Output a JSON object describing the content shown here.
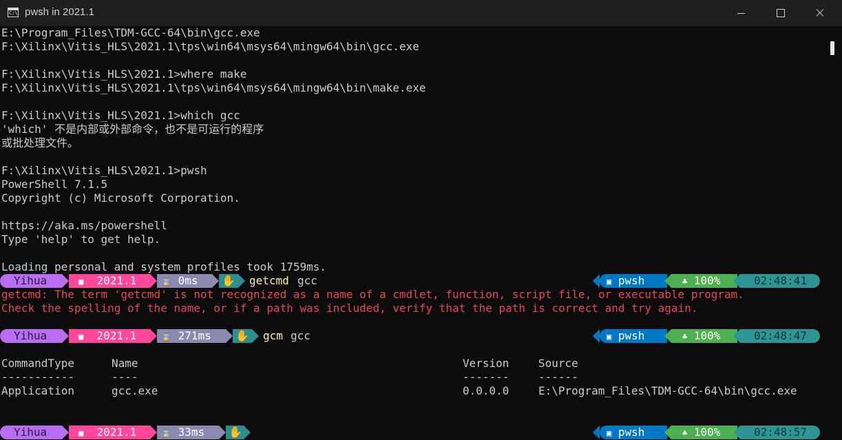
{
  "window": {
    "title": "pwsh in 2021.1"
  },
  "console": {
    "lines": [
      "E:\\Program_Files\\TDM-GCC-64\\bin\\gcc.exe",
      "F:\\Xilinx\\Vitis_HLS\\2021.1\\tps\\win64\\msys64\\mingw64\\bin\\gcc.exe",
      "",
      "F:\\Xilinx\\Vitis_HLS\\2021.1>where make",
      "F:\\Xilinx\\Vitis_HLS\\2021.1\\tps\\win64\\msys64\\mingw64\\bin\\make.exe",
      "",
      "F:\\Xilinx\\Vitis_HLS\\2021.1>which gcc",
      "'which' 不是内部或外部命令，也不是可运行的程序",
      "或批处理文件。",
      "",
      "F:\\Xilinx\\Vitis_HLS\\2021.1>pwsh",
      "PowerShell 7.1.5",
      "Copyright (c) Microsoft Corporation.",
      "",
      "https://aka.ms/powershell",
      "Type 'help' to get help.",
      "",
      "Loading personal and system profiles took 1759ms."
    ],
    "errors": [
      "getcmd: The term 'getcmd' is not recognized as a name of a cmdlet, function, script file, or executable program.",
      "Check the spelling of the name, or if a path was included, verify that the path is correct and try again."
    ],
    "table": {
      "headers": [
        "CommandType",
        "Name",
        "Version",
        "Source"
      ],
      "dashes": [
        "-----------",
        "----",
        "-------",
        "------"
      ],
      "row": [
        "Application",
        "gcc.exe",
        "0.0.0.0",
        "E:\\Program_Files\\TDM-GCC-64\\bin\\gcc.exe"
      ]
    }
  },
  "prompts": [
    {
      "user": "Yihua",
      "folder": "2021.1",
      "elapsed": "0ms",
      "command": "getcmd",
      "arg": "gcc",
      "shell": "pwsh",
      "battery": "100%",
      "clock": "02:48:41"
    },
    {
      "user": "Yihua",
      "folder": "2021.1",
      "elapsed": "271ms",
      "command": "gcm",
      "arg": "gcc",
      "shell": "pwsh",
      "battery": "100%",
      "clock": "02:48:47"
    },
    {
      "user": "Yihua",
      "folder": "2021.1",
      "elapsed": "33ms",
      "command": "",
      "arg": "",
      "shell": "pwsh",
      "battery": "100%",
      "clock": "02:48:57"
    }
  ],
  "colors": {
    "background": "#0c0c0c",
    "text": "#cccccc",
    "error": "#e74856",
    "command": "#f9f1a5",
    "user_segment": "#b86df2",
    "path_segment": "#ff479c",
    "time_segment": "#8a8ab0",
    "git_segment": "#2b8f8f",
    "shell_segment": "#0077c2",
    "battery_segment": "#4caf50",
    "clock_segment": "#2d9595"
  },
  "icons": {
    "folder": "folder-icon",
    "hourglass": "hourglass-icon",
    "git": "git-hand-icon",
    "shell": "terminal-icon",
    "battery": "plant-icon"
  }
}
